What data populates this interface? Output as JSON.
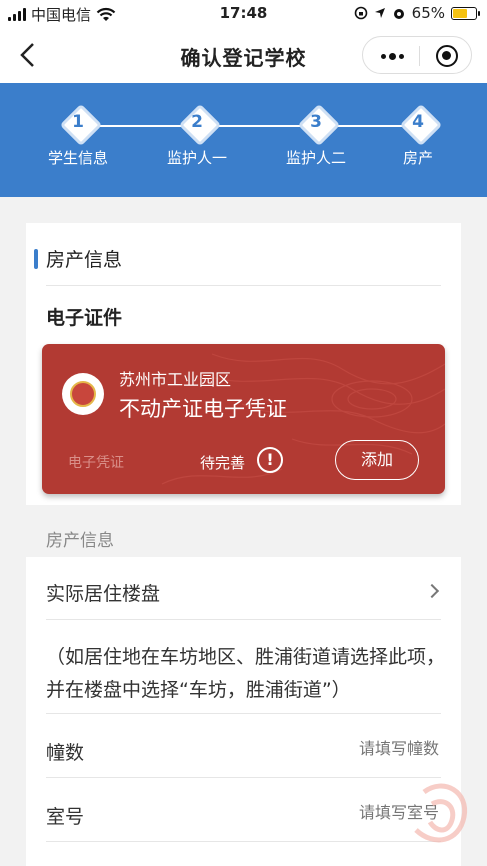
{
  "status_bar": {
    "carrier": "中国电信",
    "time": "17:48",
    "battery": "65%",
    "battery_level": 0.65
  },
  "nav": {
    "title": "确认登记学校"
  },
  "steps": [
    {
      "num": "1",
      "label": "学生信息"
    },
    {
      "num": "2",
      "label": "监护人一"
    },
    {
      "num": "3",
      "label": "监护人二"
    },
    {
      "num": "4",
      "label": "房产"
    }
  ],
  "section": {
    "title": "房产信息",
    "ecert_title": "电子证件"
  },
  "certificate": {
    "region": "苏州市工业园区",
    "name": "不动产证电子凭证",
    "tag": "电子凭证",
    "status": "待完善",
    "alert_symbol": "!",
    "add_label": "添加"
  },
  "form": {
    "group_label": "房产信息",
    "residence_label": "实际居住楼盘",
    "note": "（如居住地在车坊地区、胜浦街道请选择此项，并在楼盘中选择“车坊，胜浦街道”）",
    "building_label": "幢数",
    "building_placeholder": "请填写幢数",
    "room_label": "室号",
    "room_placeholder": "请填写室号"
  },
  "colors": {
    "accent": "#3b7ecb",
    "cert_red": "#b23a33"
  }
}
